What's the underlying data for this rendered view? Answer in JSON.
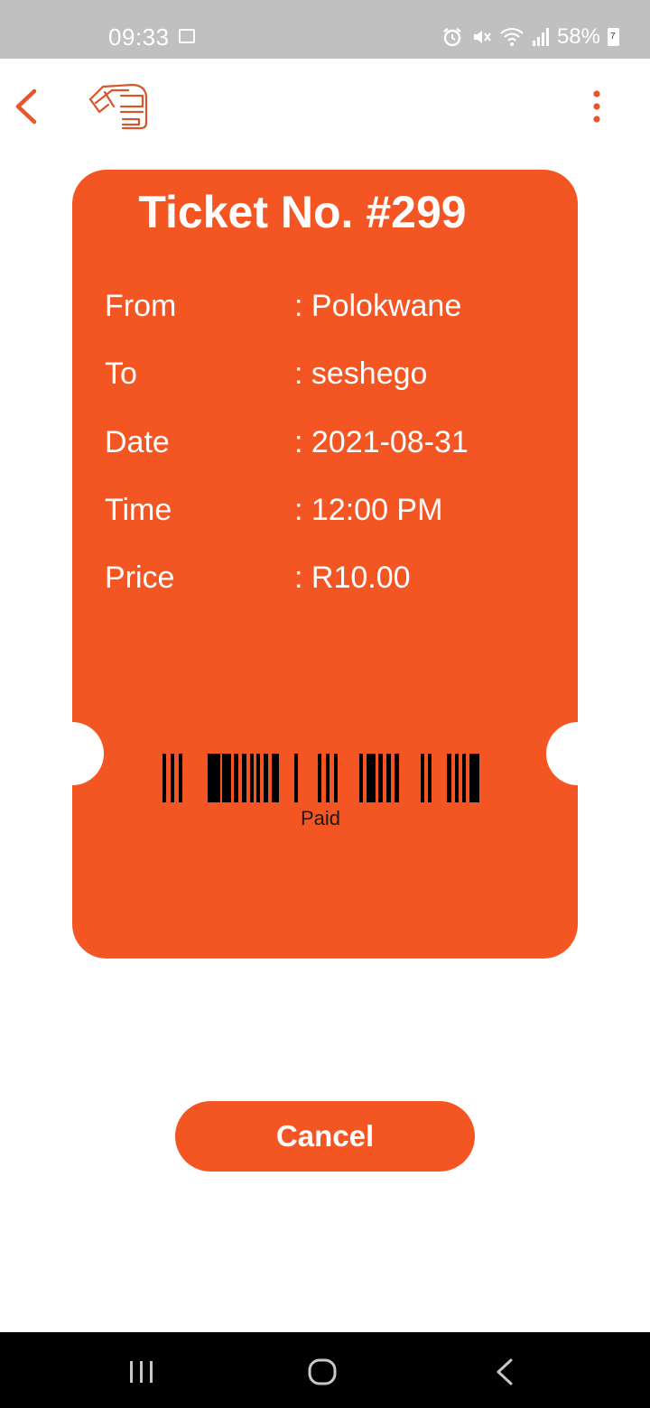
{
  "status_bar": {
    "time": "09:33",
    "battery_percent": "58%",
    "battery_level_label": "7",
    "icons": [
      "gallery-icon",
      "alarm-icon",
      "mute-icon",
      "wifi-icon",
      "signal-icon",
      "battery-icon"
    ]
  },
  "app_bar": {
    "icons": [
      "back-arrow-icon",
      "bus-logo-icon",
      "more-vert-icon"
    ]
  },
  "ticket": {
    "title": "Ticket No. #299",
    "rows": [
      {
        "label": "From",
        "value": ": Polokwane"
      },
      {
        "label": "To",
        "value": ": seshego"
      },
      {
        "label": "Date",
        "value": ": 2021-08-31"
      },
      {
        "label": "Time",
        "value": ": 12:00 PM"
      },
      {
        "label": "Price",
        "value": ": R10.00"
      }
    ],
    "barcode_text": "Paid"
  },
  "actions": {
    "cancel_label": "Cancel"
  },
  "colors": {
    "accent": "#f45623",
    "status_bar": "#c0c0c0",
    "nav_bar": "#000000"
  }
}
